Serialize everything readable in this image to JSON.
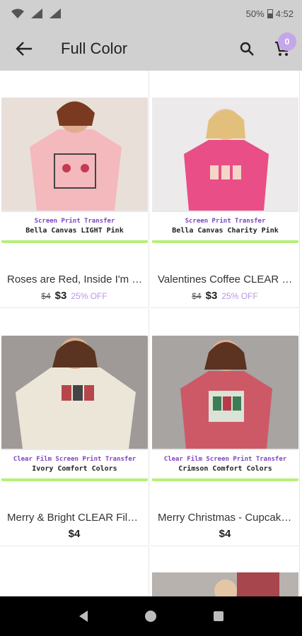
{
  "status_bar": {
    "battery": "50%",
    "time": "4:52"
  },
  "app_bar": {
    "title": "Full Color",
    "cart_count": "0"
  },
  "products": [
    {
      "name": "Roses are Red, Inside I'm Dead - Skeletons CLEAR Film Screen Print Transfer",
      "banner_top": "Screen Print Transfer",
      "banner_bottom": "Bella Canvas LIGHT Pink",
      "old_price": "$4",
      "price": "$3",
      "discount": "25% OFF",
      "photo_color": "#f3c9c9"
    },
    {
      "name": "Valentines Coffee CLEAR Film Screen Print Transfer",
      "banner_top": "Screen Print Transfer",
      "banner_bottom": "Bella Canvas Charity Pink",
      "old_price": "$4",
      "price": "$3",
      "discount": "25% OFF",
      "photo_color": "#e9668d"
    },
    {
      "name": "Merry & Bright CLEAR Film Screen Print Transfer",
      "banner_top": "Clear Film Screen Print Transfer",
      "banner_bottom": "Ivory Comfort Colors",
      "price": "$4",
      "photo_color": "#e7e1d6"
    },
    {
      "name": "Merry Christmas - Cupcakes CLEAR Film Screen Print Transfer",
      "banner_top": "Clear Film Screen Print Transfer",
      "banner_bottom": "Crimson Comfort Colors",
      "price": "$4",
      "photo_color": "#cd6d76"
    }
  ]
}
